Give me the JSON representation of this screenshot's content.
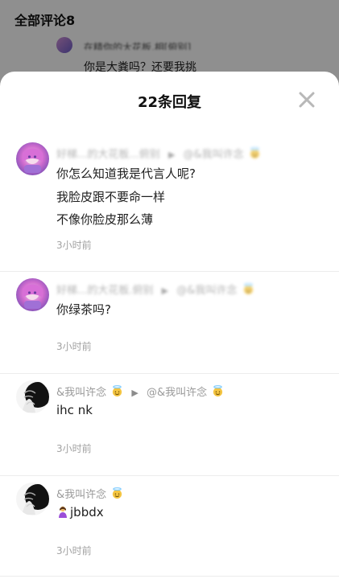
{
  "background": {
    "header": "全部评论8",
    "preview_blurred": "在精你的大花板.相[俯别]",
    "preview_text": "你是大粪吗？还要我挑"
  },
  "modal": {
    "title": "22条回复",
    "close_icon": "close-icon"
  },
  "replies": [
    {
      "meta_left": "好梯...的大花板...俯别",
      "meta_right": "@&我叫许念",
      "lines": [
        "你怎么知道我是代言人呢?",
        "我脸皮跟不要命一样",
        "不像你脸皮那么薄"
      ],
      "time": "3小时前"
    },
    {
      "meta_left": "好梯...的大花板.俯别",
      "meta_right": "@&我叫许念",
      "lines": [
        "你绿茶吗?"
      ],
      "time": "3小时前"
    },
    {
      "meta_left": "&我叫许念",
      "meta_right": "@&我叫许念",
      "lines": [
        "ihc nk"
      ],
      "time": "3小时前"
    },
    {
      "meta_left": "&我叫许念",
      "meta_right": "",
      "lines": [
        "jbbdx"
      ],
      "time": "3小时前"
    }
  ],
  "colors": {
    "overlay": "#8f8f8f",
    "text_primary": "#1e1e1e",
    "text_secondary": "#9a9a9a",
    "separator": "#ececec"
  },
  "icons": {
    "close": "close-icon",
    "angel": "angel-emoji-icon",
    "person": "person-emoji-icon",
    "arrow": "reply-arrow-icon"
  }
}
